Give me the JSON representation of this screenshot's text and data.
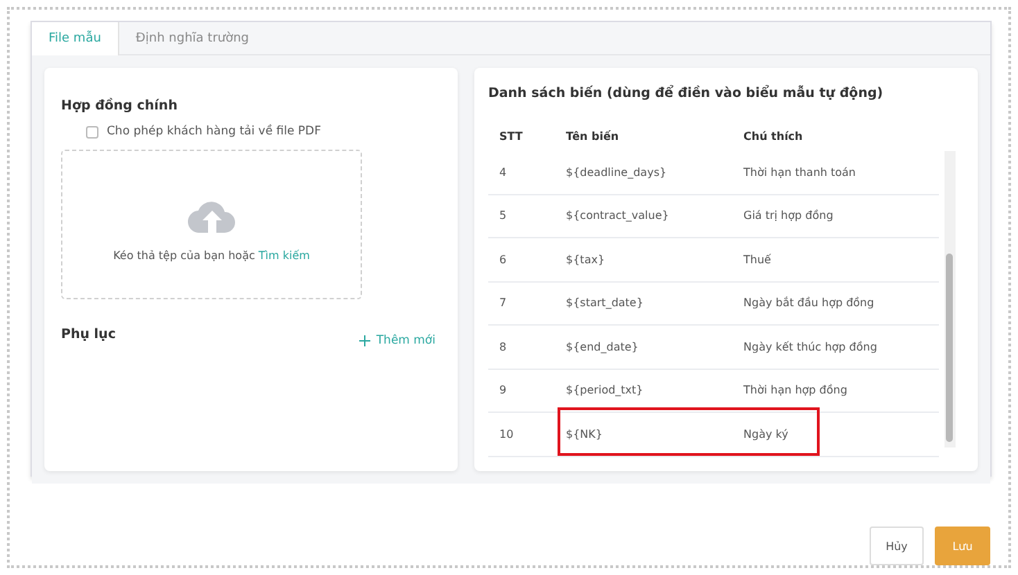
{
  "tabs": [
    {
      "label": "File mẫu",
      "selected": true
    },
    {
      "label": "Định nghĩa trường",
      "selected": false
    }
  ],
  "main_contract": {
    "title": "Hợp đồng chính",
    "allow_pdf": {
      "label": "Cho phép khách hàng tải về file PDF",
      "checked": false
    },
    "dropzone": {
      "text": "Kéo thả tệp của bạn hoặc",
      "link": "Tìm kiếm"
    }
  },
  "appendix": {
    "title": "Phụ lục",
    "add_label": "Thêm mới"
  },
  "variables": {
    "title": "Danh sách biến (dùng để điền vào biểu mẫu tự động)",
    "columns": [
      "STT",
      "Tên biến",
      "Chú thích"
    ],
    "rows": [
      {
        "stt": "4",
        "name": "${deadline_days}",
        "note": "Thời hạn thanh toán",
        "highlighted": false
      },
      {
        "stt": "5",
        "name": "${contract_value}",
        "note": "Giá trị hợp đồng",
        "highlighted": false
      },
      {
        "stt": "6",
        "name": "${tax}",
        "note": "Thuế",
        "highlighted": false
      },
      {
        "stt": "7",
        "name": "${start_date}",
        "note": "Ngày bắt đầu hợp đồng",
        "highlighted": false
      },
      {
        "stt": "8",
        "name": "${end_date}",
        "note": "Ngày kết thúc hợp đồng",
        "highlighted": false
      },
      {
        "stt": "9",
        "name": "${period_txt}",
        "note": "Thời hạn hợp đồng",
        "highlighted": false
      },
      {
        "stt": "10",
        "name": "${NK}",
        "note": "Ngày ký",
        "highlighted": true
      }
    ]
  },
  "buttons": [
    {
      "label": "Hủy",
      "kind": "secondary"
    },
    {
      "label": "Lưu",
      "kind": "primary"
    }
  ]
}
